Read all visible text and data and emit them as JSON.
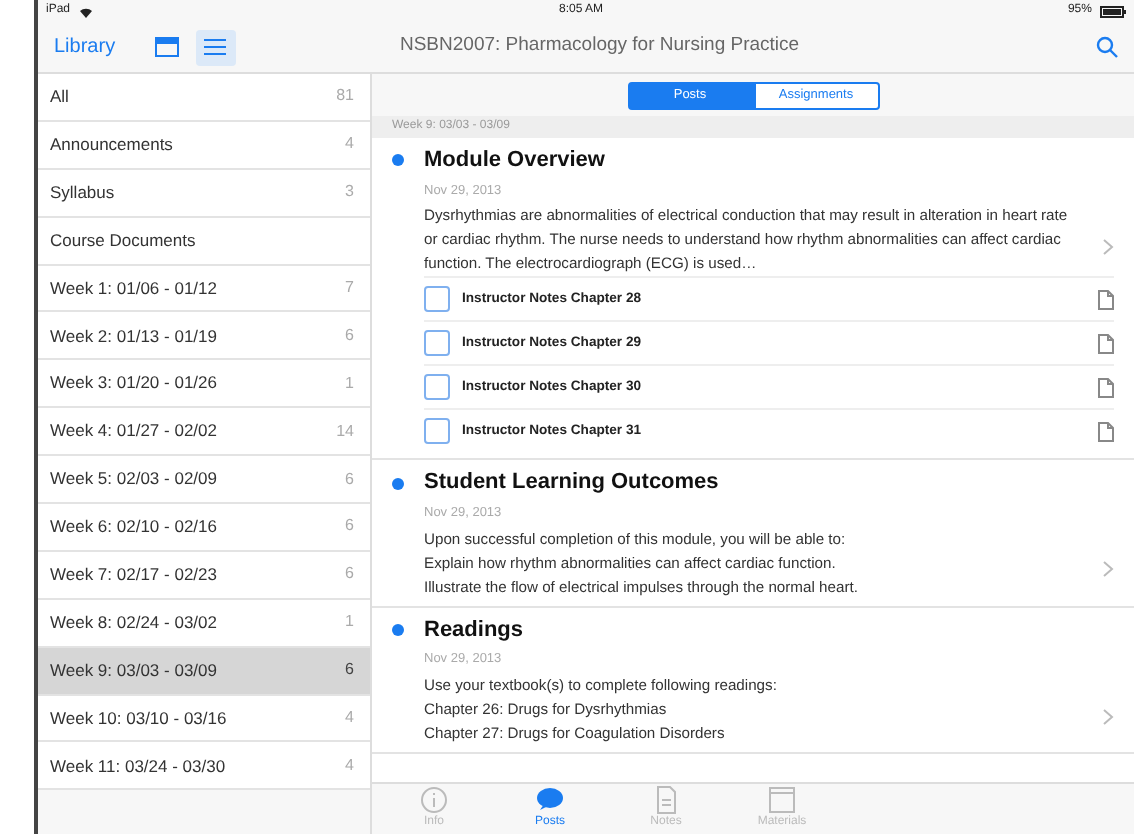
{
  "status_bar": {
    "device": "iPad",
    "time": "8:05 AM",
    "battery": "95%"
  },
  "nav": {
    "library": "Library",
    "view_modes": [
      {
        "kind": "grid",
        "selected": false
      },
      {
        "kind": "list",
        "selected": true
      }
    ],
    "title": "NSBN2007: Pharmacology for Nursing Practice"
  },
  "sidebar": {
    "items": [
      {
        "label": "All",
        "count": "81",
        "selected": false
      },
      {
        "label": "Announcements",
        "count": "4",
        "selected": false
      },
      {
        "label": "Syllabus",
        "count": "3",
        "selected": false
      },
      {
        "label": "Course Documents",
        "selected": false
      },
      {
        "label": "Week 1: 01/06 - 01/12",
        "count": "7",
        "selected": false
      },
      {
        "label": "Week 2: 01/13 - 01/19",
        "count": "6",
        "selected": false
      },
      {
        "label": "Week 3: 01/20 - 01/26",
        "count": "1",
        "selected": false
      },
      {
        "label": "Week 4: 01/27 - 02/02",
        "count": "14",
        "selected": false
      },
      {
        "label": "Week 5: 02/03 - 02/09",
        "count": "6",
        "selected": false
      },
      {
        "label": "Week 6: 02/10 - 02/16",
        "count": "6",
        "selected": false
      },
      {
        "label": "Week 7: 02/17 - 02/23",
        "count": "6",
        "selected": false
      },
      {
        "label": "Week 8: 02/24 - 03/02",
        "count": "1",
        "selected": false
      },
      {
        "label": "Week 9: 03/03 - 03/09",
        "count": "6",
        "selected": true
      },
      {
        "label": "Week 10: 03/10 - 03/16",
        "count": "4",
        "selected": false
      },
      {
        "label": "Week 11: 03/24 - 03/30",
        "count": "4",
        "selected": false
      }
    ]
  },
  "segments": [
    {
      "label": "Posts",
      "selected": true
    },
    {
      "label": "Assignments",
      "selected": false
    }
  ],
  "section_header": "Week 9: 03/03 - 03/09",
  "posts": [
    {
      "title": "Module Overview",
      "date": "Nov 29, 2013",
      "unread": true,
      "body": [
        "Dysrhythmias are abnormalities of electrical conduction that may result in alteration in heart rate or cardiac rhythm.  The nurse needs to understand how rhythm abnormalities can affect cardiac function.  The electrocardiograph (ECG) is used…"
      ],
      "attachments": [
        {
          "label": "Instructor Notes Chapter 28",
          "checked": false
        },
        {
          "label": "Instructor Notes Chapter 29",
          "checked": false
        },
        {
          "label": "Instructor Notes Chapter 30",
          "checked": false
        },
        {
          "label": "Instructor Notes Chapter 31",
          "checked": false
        }
      ]
    },
    {
      "title": "Student Learning Outcomes",
      "date": "Nov 29, 2013",
      "unread": true,
      "body": [
        "Upon successful completion of this module, you will be able to:",
        "Explain how rhythm abnormalities can affect cardiac function.",
        "Illustrate the flow of electrical impulses through the normal heart."
      ]
    },
    {
      "title": "Readings",
      "date": "Nov 29, 2013",
      "unread": true,
      "body": [
        "Use your textbook(s) to complete following readings:",
        "Chapter 26:  Drugs for Dysrhythmias",
        "Chapter 27:  Drugs for Coagulation Disorders"
      ]
    }
  ],
  "tab_bar": [
    {
      "kind": "info",
      "label": "Info",
      "selected": false
    },
    {
      "kind": "posts",
      "label": "Posts",
      "selected": true
    },
    {
      "kind": "notes",
      "label": "Notes",
      "selected": false
    },
    {
      "kind": "materials",
      "label": "Materials",
      "selected": false
    }
  ]
}
